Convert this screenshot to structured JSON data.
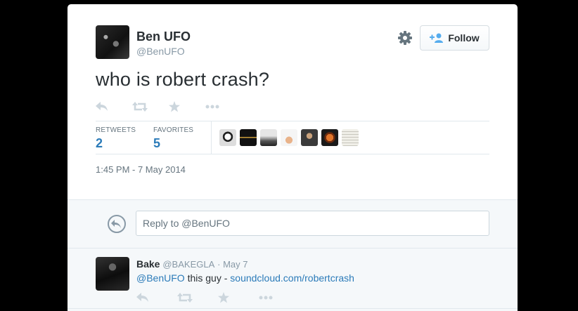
{
  "tweet": {
    "author_name": "Ben UFO",
    "author_handle": "@BenUFO",
    "text": "who is robert crash?",
    "follow_label": "Follow",
    "stats": {
      "retweets_label": "RETWEETS",
      "retweets_count": "2",
      "favorites_label": "FAVORITES",
      "favorites_count": "5"
    },
    "timestamp": "1:45 PM - 7 May 2014",
    "actions": [
      "reply-icon",
      "retweet-icon",
      "favorite-icon",
      "more-icon"
    ]
  },
  "reply_box": {
    "placeholder": "Reply to @BenUFO"
  },
  "reply": {
    "author_name": "Bake",
    "author_handle": "@BAKEGLA",
    "date": "· May 7",
    "mention": "@BenUFO",
    "text": " this guy - ",
    "link": "soundcloud.com/robertcrash"
  },
  "colors": {
    "link": "#2b7bb9",
    "muted": "#8899a6",
    "text": "#292f33",
    "reply_bg": "#f5f8fa",
    "divider": "#e1e8ed",
    "icon": "#ccd6dd"
  }
}
